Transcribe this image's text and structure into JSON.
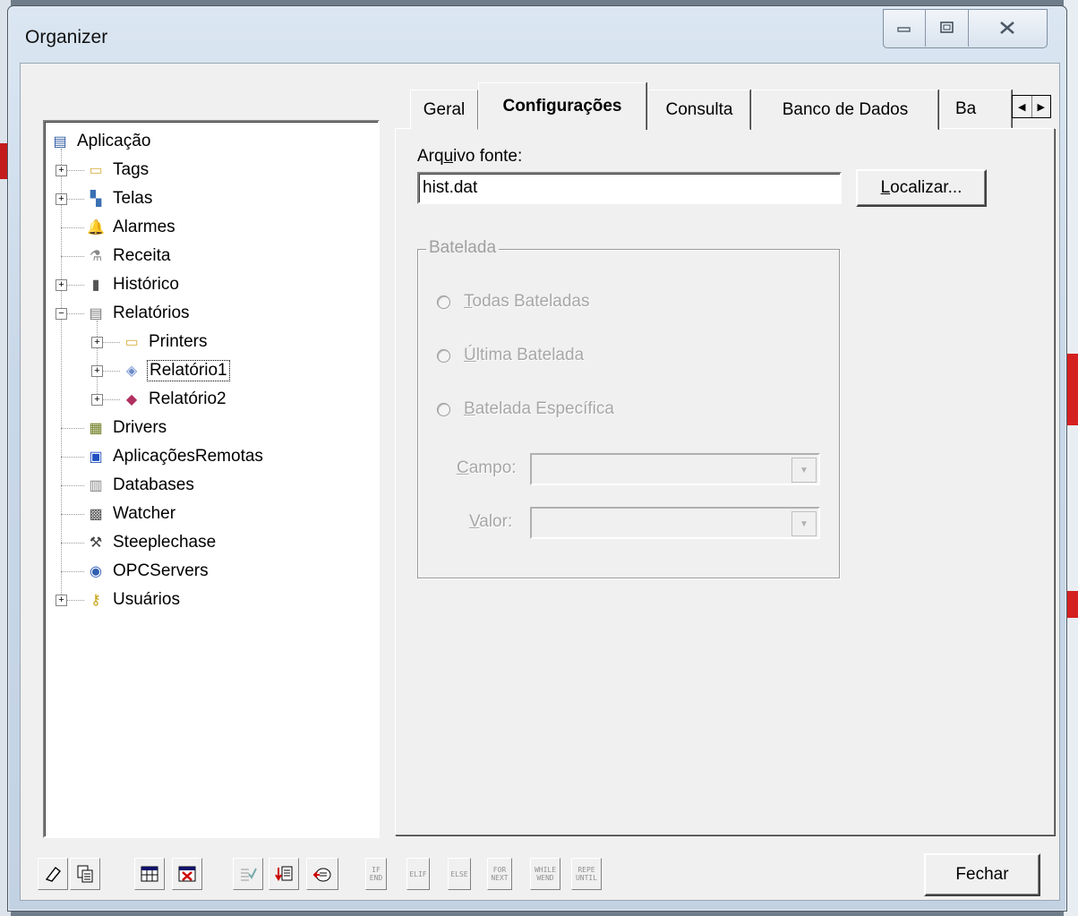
{
  "window": {
    "title": "Organizer",
    "min_icon": "minimize-icon",
    "max_icon": "maximize-icon",
    "close_icon": "close-icon"
  },
  "tree": {
    "items": [
      {
        "label": "Aplicação",
        "icon": "application-icon"
      },
      {
        "label": "Tags",
        "icon": "tag-folder-icon"
      },
      {
        "label": "Telas",
        "icon": "screens-icon"
      },
      {
        "label": "Alarmes",
        "icon": "bell-icon"
      },
      {
        "label": "Receita",
        "icon": "recipe-icon"
      },
      {
        "label": "Histórico",
        "icon": "history-icon"
      },
      {
        "label": "Relatórios",
        "icon": "report-icon"
      },
      {
        "label": "Printers",
        "icon": "printer-folder-icon"
      },
      {
        "label": "Relatório1",
        "icon": "text-report-icon"
      },
      {
        "label": "Relatório2",
        "icon": "graphic-report-icon"
      },
      {
        "label": "Drivers",
        "icon": "drivers-icon"
      },
      {
        "label": "AplicaçõesRemotas",
        "icon": "remote-apps-icon"
      },
      {
        "label": "Databases",
        "icon": "database-icon"
      },
      {
        "label": "Watcher",
        "icon": "watcher-icon"
      },
      {
        "label": "Steeplechase",
        "icon": "steeplechase-icon"
      },
      {
        "label": "OPCServers",
        "icon": "opc-server-icon"
      },
      {
        "label": "Usuários",
        "icon": "key-icon"
      }
    ]
  },
  "tabs": [
    "Geral",
    "Configurações",
    "Consulta",
    "Banco de Dados",
    "Ba"
  ],
  "active_tab": "Configurações",
  "form": {
    "arquivo_label_pre": "Arq",
    "arquivo_label_u": "u",
    "arquivo_label_post": "ivo fonte:",
    "arquivo_value": "hist.dat",
    "localizar_u": "L",
    "localizar_rest": "ocalizar...",
    "group_title": "Batelada",
    "radio1_u": "T",
    "radio1_rest": "odas Bateladas",
    "radio2_u": "Ú",
    "radio2_rest": "ltima Batelada",
    "radio3_u": "B",
    "radio3_rest": "atelada Específica",
    "campo_u": "C",
    "campo_rest": "ampo:",
    "valor_u": "V",
    "valor_rest": "alor:"
  },
  "toolbar": {
    "buttons": [
      {
        "icon": "eraser-icon"
      },
      {
        "icon": "copy-icon"
      },
      {
        "icon": "table-icon"
      },
      {
        "icon": "table-delete-icon"
      },
      {
        "icon": "check-list-icon"
      },
      {
        "icon": "import-icon"
      },
      {
        "icon": "export-icon"
      }
    ],
    "code_buttons": [
      {
        "top": "IF",
        "bottom": "END"
      },
      {
        "top": "ELIF",
        "bottom": ""
      },
      {
        "top": "ELSE",
        "bottom": ""
      },
      {
        "top": "FOR",
        "bottom": "NEXT"
      },
      {
        "top": "WHILE",
        "bottom": "WEND"
      },
      {
        "top": "REPE",
        "bottom": "UNTIL"
      }
    ],
    "close_label": "Fechar"
  }
}
